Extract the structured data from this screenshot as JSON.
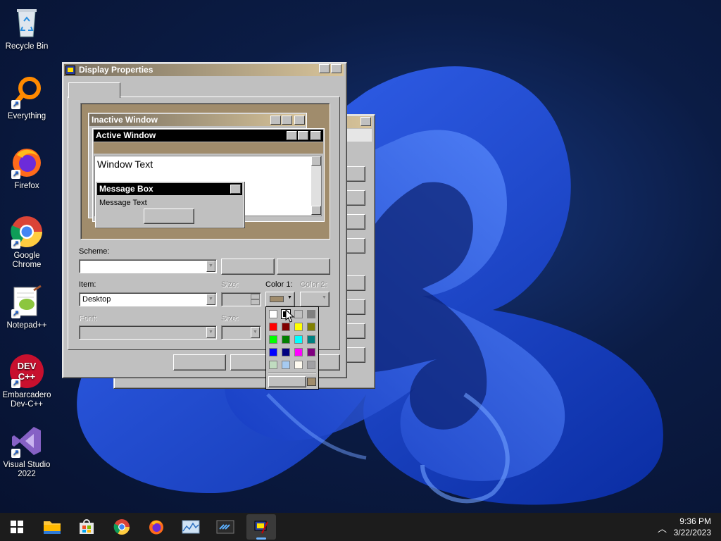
{
  "desktop": {
    "icons": [
      {
        "label": "Recycle Bin"
      },
      {
        "label": "Everything"
      },
      {
        "label": "Firefox"
      },
      {
        "label": "Google Chrome"
      },
      {
        "label": "Notepad++"
      },
      {
        "label": "Embarcadero Dev-C++"
      },
      {
        "label": "Visual Studio 2022"
      }
    ],
    "devcpp_logo": "DEV C++"
  },
  "dialog": {
    "title": "Display Properties",
    "preview": {
      "inactive_title": "Inactive Window",
      "active_title": "Active Window",
      "window_text": "Window Text",
      "msgbox_title": "Message Box",
      "msgbox_text": "Message Text"
    },
    "scheme_label": "Scheme:",
    "item_label": "Item:",
    "item_value": "Desktop",
    "size_label": "Size:",
    "color1_label": "Color 1:",
    "color2_label": "Color 2:",
    "font_label": "Font:",
    "font_size_label": "Size:"
  },
  "palette": {
    "colors": [
      "#ffffff",
      "#000000",
      "#c0c0c0",
      "#808080",
      "#ff0000",
      "#800000",
      "#ffff00",
      "#808000",
      "#00ff00",
      "#008000",
      "#00ffff",
      "#008080",
      "#0000ff",
      "#000080",
      "#ff00ff",
      "#800080",
      "#c0dcc0",
      "#a6caf0",
      "#fffbf0",
      "#a0a0a4"
    ],
    "selected_color": "#a08c6c"
  },
  "taskbar": {
    "time": "9:36 PM",
    "date": "3/22/2023"
  }
}
